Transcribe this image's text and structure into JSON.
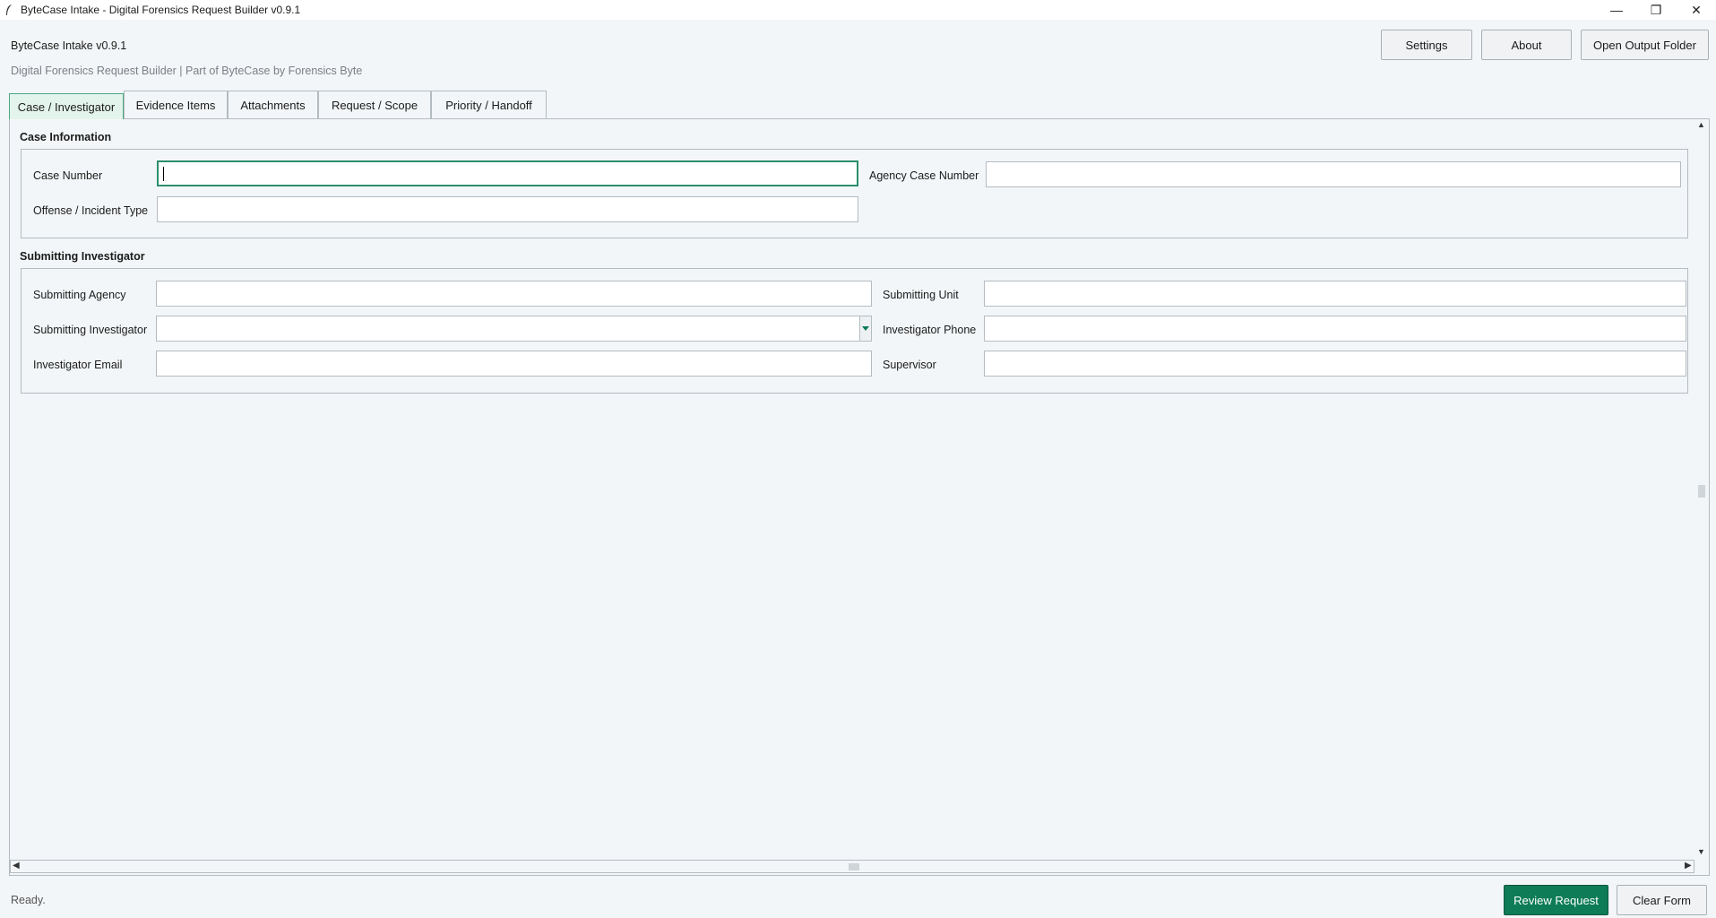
{
  "window": {
    "title": "ByteCase Intake - Digital Forensics Request Builder v0.9.1",
    "controls": {
      "minimize": "—",
      "maximize": "❐",
      "close": "✕"
    }
  },
  "header": {
    "app_name": "ByteCase Intake v0.9.1",
    "subtitle": "Digital Forensics Request Builder | Part of ByteCase by Forensics Byte",
    "buttons": {
      "settings": "Settings",
      "about": "About",
      "open_output": "Open Output Folder"
    }
  },
  "tabs": [
    {
      "label": "Case / Investigator",
      "active": true
    },
    {
      "label": "Evidence Items",
      "active": false
    },
    {
      "label": "Attachments",
      "active": false
    },
    {
      "label": "Request / Scope",
      "active": false
    },
    {
      "label": "Priority / Handoff",
      "active": false
    }
  ],
  "case_info": {
    "title": "Case Information",
    "case_number": {
      "label": "Case Number",
      "value": ""
    },
    "agency_case_number": {
      "label": "Agency Case Number",
      "value": ""
    },
    "offense_type": {
      "label": "Offense / Incident Type",
      "value": ""
    }
  },
  "investigator": {
    "title": "Submitting Investigator",
    "agency": {
      "label": "Submitting Agency",
      "value": ""
    },
    "unit": {
      "label": "Submitting Unit",
      "value": ""
    },
    "investigator": {
      "label": "Submitting Investigator",
      "value": ""
    },
    "phone": {
      "label": "Investigator Phone",
      "value": ""
    },
    "email": {
      "label": "Investigator Email",
      "value": ""
    },
    "supervisor": {
      "label": "Supervisor",
      "value": ""
    }
  },
  "footer": {
    "status": "Ready.",
    "review_label": "Review Request",
    "clear_label": "Clear Form"
  },
  "colors": {
    "accent": "#0d7c57",
    "focus_border": "#2a8f6b",
    "active_tab_bg": "#e3f4ec",
    "background": "#f3f6f8"
  },
  "icons": {
    "app": "feather-icon",
    "dropdown": "caret-down-icon",
    "scroll_up": "arrow-up-icon",
    "scroll_down": "arrow-down-icon",
    "scroll_left": "arrow-left-icon",
    "scroll_right": "arrow-right-icon"
  }
}
